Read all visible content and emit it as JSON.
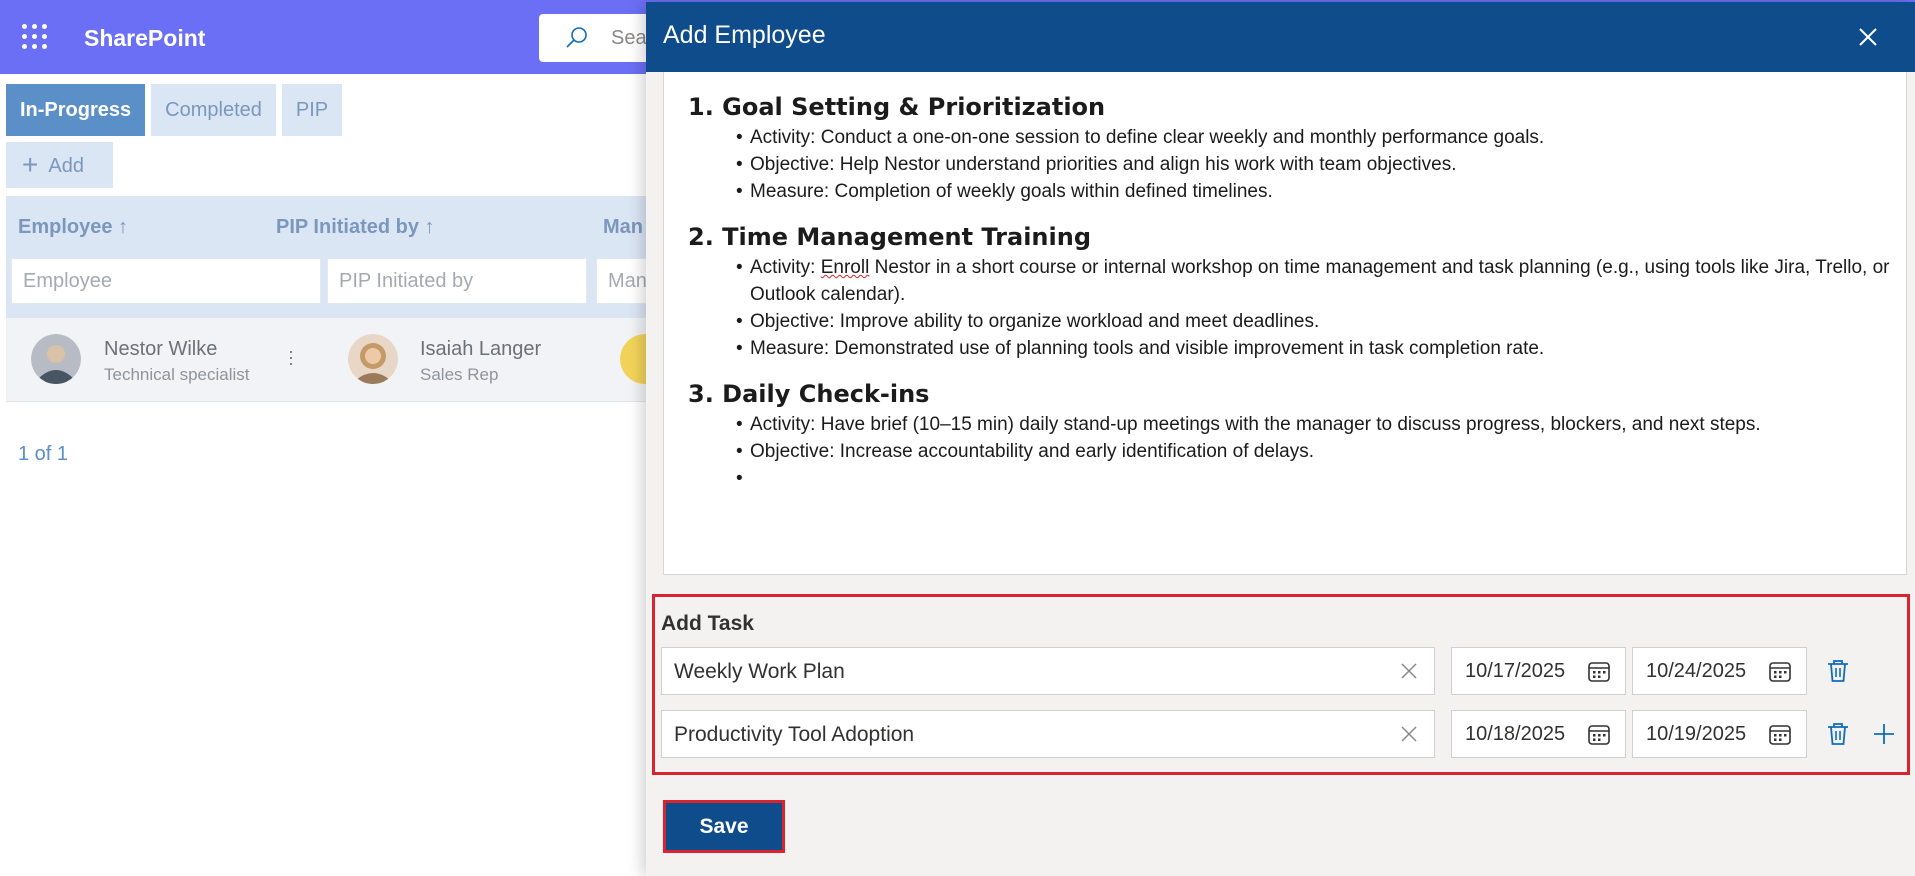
{
  "app": {
    "title": "SharePoint",
    "search_placeholder": "Sea"
  },
  "background": {
    "tabs": [
      {
        "label": "In-Progress",
        "active": true
      },
      {
        "label": "Completed",
        "active": false
      },
      {
        "label": "PIP",
        "active": false
      }
    ],
    "add_label": "Add",
    "columns": [
      {
        "label": "Employee ↑",
        "filter_placeholder": "Employee"
      },
      {
        "label": "PIP Initiated by ↑",
        "filter_placeholder": "PIP Initiated by"
      },
      {
        "label": "Man",
        "filter_placeholder": "Man"
      }
    ],
    "row": {
      "employee": {
        "name": "Nestor Wilke",
        "role": "Technical specialist"
      },
      "initiator": {
        "name": "Isaiah Langer",
        "role": "Sales Rep"
      }
    },
    "pager": "1 of 1"
  },
  "panel": {
    "title": "Add Employee",
    "sections": [
      {
        "heading": "1. Goal Setting & Prioritization",
        "items": [
          "Activity: Conduct a one-on-one session to define clear weekly and monthly performance goals.",
          "Objective: Help Nestor understand priorities and align his work with team objectives.",
          "Measure: Completion of weekly goals within defined timelines."
        ]
      },
      {
        "heading": "2. Time Management Training",
        "items": [
          "Activity: Enroll Nestor in a short course or internal workshop on time management and task planning (e.g., using tools like Jira, Trello, or Outlook calendar).",
          "Objective: Improve ability to organize workload and meet deadlines.",
          "Measure: Demonstrated use of planning tools and visible improvement in task completion rate."
        ]
      },
      {
        "heading": "3. Daily Check-ins",
        "items": [
          "Activity: Have brief (10–15 min) daily stand-up meetings with the manager to discuss progress, blockers, and next steps.",
          "Objective: Increase accountability and early identification of delays.",
          ""
        ]
      }
    ],
    "task_label": "Add Task",
    "tasks": [
      {
        "name": "Weekly Work Plan",
        "start": "10/17/2025",
        "end": "10/24/2025"
      },
      {
        "name": "Productivity Tool Adoption",
        "start": "10/18/2025",
        "end": "10/19/2025"
      }
    ],
    "save_label": "Save"
  },
  "colors": {
    "header_blue": "#0e4c8b",
    "suite_bar": "#6b6ff5",
    "highlight_red": "#d9232e",
    "accent_blue": "#0f6cbd"
  }
}
